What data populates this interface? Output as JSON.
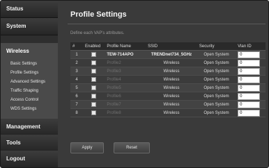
{
  "sidebar": {
    "status": "Status",
    "system": "System",
    "wireless": "Wireless",
    "wireless_items": [
      "Basic Settings",
      "Profile Settings",
      "Advanced Settings",
      "Traffic Shaping",
      "Access Control",
      "WDS Settings"
    ],
    "management": "Management",
    "tools": "Tools",
    "logout": "Logout"
  },
  "main": {
    "title": "Profile Settings",
    "hint": "Define each VAP's attributes.",
    "columns": [
      "#",
      "Enabled",
      "Profile Name",
      "SSID",
      "Security",
      "Vlan ID"
    ],
    "rows": [
      {
        "num": "1",
        "profile": "TEW-714APO",
        "ssid": "TRENDnet734_5GHz",
        "security": "Open System",
        "vlan": "0"
      },
      {
        "num": "2",
        "profile": "Profile2",
        "ssid": "Wireless",
        "security": "Open System",
        "vlan": "0"
      },
      {
        "num": "3",
        "profile": "Profile3",
        "ssid": "Wireless",
        "security": "Open System",
        "vlan": "0"
      },
      {
        "num": "4",
        "profile": "Profile4",
        "ssid": "Wireless",
        "security": "Open System",
        "vlan": "0"
      },
      {
        "num": "5",
        "profile": "Profile5",
        "ssid": "Wireless",
        "security": "Open System",
        "vlan": "0"
      },
      {
        "num": "6",
        "profile": "Profile6",
        "ssid": "Wireless",
        "security": "Open System",
        "vlan": "0"
      },
      {
        "num": "7",
        "profile": "Profile7",
        "ssid": "Wireless",
        "security": "Open System",
        "vlan": "0"
      },
      {
        "num": "8",
        "profile": "Profile8",
        "ssid": "Wireless",
        "security": "Open System",
        "vlan": "0"
      }
    ],
    "apply_label": "Apply",
    "reset_label": "Reset"
  }
}
